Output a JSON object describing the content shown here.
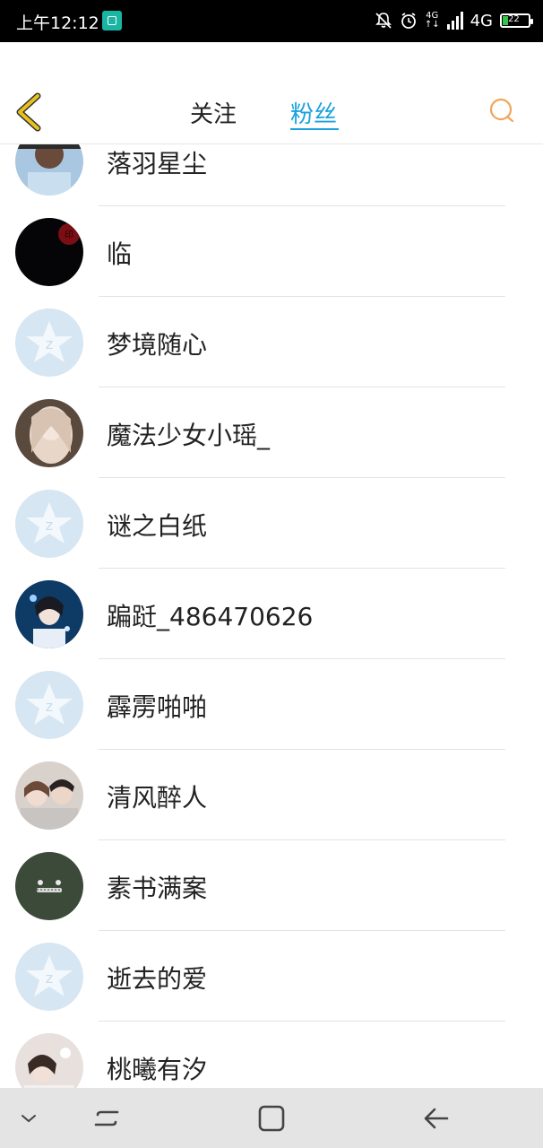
{
  "status_bar": {
    "time": "上午12:12",
    "net_small_top": "4G",
    "net_small_bottom": "↑↓",
    "network": "4G",
    "battery": "22"
  },
  "header": {
    "back_icon": "chevron-left-icon",
    "tabs": [
      {
        "label": "关注",
        "active": false
      },
      {
        "label": "粉丝",
        "active": true
      }
    ],
    "search_icon": "search-icon",
    "accent_color": "#1aa2dc",
    "back_color": "#e8c21c",
    "search_color": "#f0a65a"
  },
  "fans": [
    {
      "name": "落羽星尘",
      "avatar": "photo"
    },
    {
      "name": "临",
      "avatar": "dark-seal"
    },
    {
      "name": "梦境随心",
      "avatar": "default-qzone"
    },
    {
      "name": "魔法少女小瑶_",
      "avatar": "photo"
    },
    {
      "name": "谜之白纸",
      "avatar": "default-qzone"
    },
    {
      "name": "蹁跹_486470626",
      "avatar": "photo"
    },
    {
      "name": "霹雳啪啪",
      "avatar": "default-qzone"
    },
    {
      "name": "清风醉人",
      "avatar": "photo"
    },
    {
      "name": "素书满案",
      "avatar": "totoro"
    },
    {
      "name": "逝去的爱",
      "avatar": "default-qzone"
    },
    {
      "name": "桃曦有汐",
      "avatar": "photo"
    }
  ],
  "nav_bar": {
    "icons": [
      "chevron-down-icon",
      "recents-icon",
      "home-icon",
      "back-arrow-icon"
    ]
  }
}
